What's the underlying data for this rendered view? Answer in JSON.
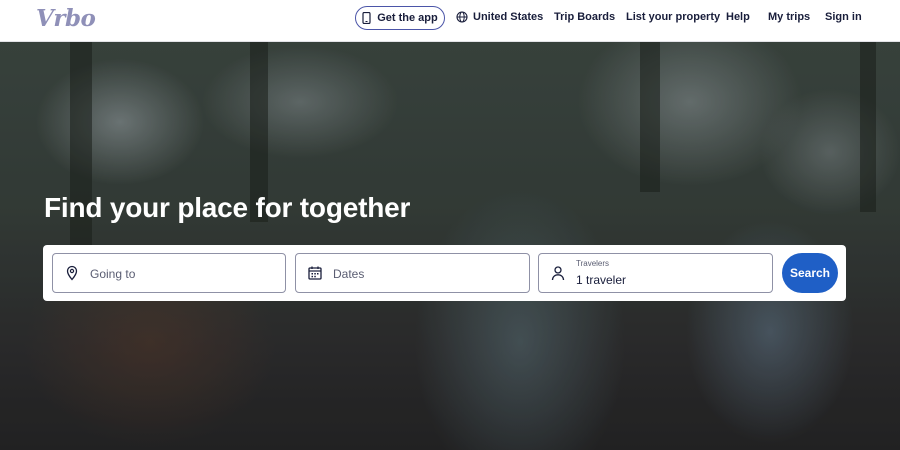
{
  "brand": {
    "logo_text": "Vrbo",
    "logo_color": "#8f90b8"
  },
  "header": {
    "get_app": {
      "label": "Get the app",
      "icon": "phone-icon"
    },
    "region": {
      "label": "United States",
      "icon": "globe-icon"
    },
    "trip_boards": "Trip Boards",
    "list_property": "List your property",
    "help": "Help",
    "my_trips": "My trips",
    "sign_in": "Sign in"
  },
  "hero": {
    "title": "Find your place for together"
  },
  "search": {
    "destination": {
      "placeholder": "Going to",
      "icon": "map-pin-icon"
    },
    "dates": {
      "placeholder": "Dates",
      "icon": "calendar-icon"
    },
    "travelers": {
      "label": "Travelers",
      "value": "1 traveler",
      "icon": "person-icon"
    },
    "button_label": "Search"
  },
  "colors": {
    "accent": "#1f5fc6",
    "text_dark": "#191e3b",
    "header_bg": "#ffffff"
  }
}
